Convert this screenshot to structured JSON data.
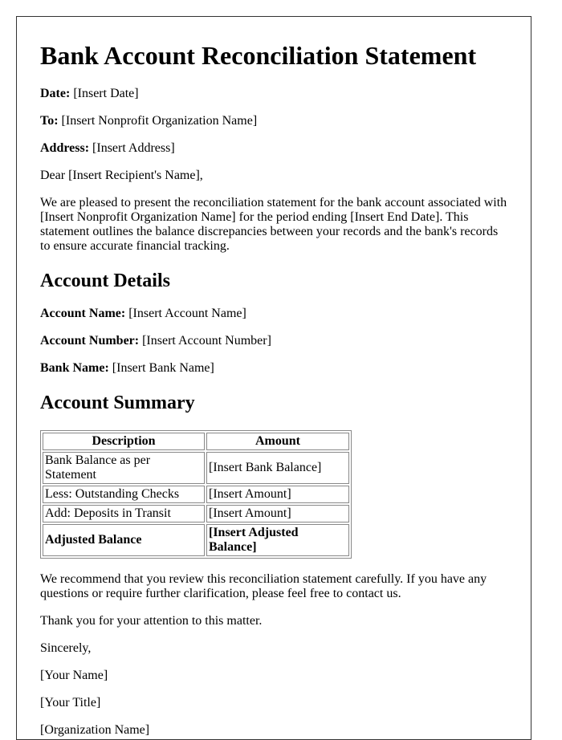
{
  "title": "Bank Account Reconciliation Statement",
  "header_fields": [
    {
      "label": "Date:",
      "value": " [Insert Date]"
    },
    {
      "label": "To:",
      "value": " [Insert Nonprofit Organization Name]"
    },
    {
      "label": "Address:",
      "value": " [Insert Address]"
    }
  ],
  "salutation": "Dear [Insert Recipient's Name],",
  "intro": "We are pleased to present the reconciliation statement for the bank account associated with [Insert Nonprofit Organization Name] for the period ending [Insert End Date]. This statement outlines the balance discrepancies between your records and the bank's records to ensure accurate financial tracking.",
  "account_details": {
    "heading": "Account Details",
    "fields": [
      {
        "label": "Account Name:",
        "value": " [Insert Account Name]"
      },
      {
        "label": "Account Number:",
        "value": " [Insert Account Number]"
      },
      {
        "label": "Bank Name:",
        "value": " [Insert Bank Name]"
      }
    ]
  },
  "account_summary": {
    "heading": "Account Summary",
    "columns": [
      "Description",
      "Amount"
    ],
    "rows": [
      {
        "description": "Bank Balance as per Statement",
        "amount": "[Insert Bank Balance]"
      },
      {
        "description": "Less: Outstanding Checks",
        "amount": "[Insert Amount]"
      },
      {
        "description": "Add: Deposits in Transit",
        "amount": "[Insert Amount]"
      },
      {
        "description": "Adjusted Balance",
        "amount": "[Insert Adjusted Balance]"
      }
    ]
  },
  "closing_paragraph": "We recommend that you review this reconciliation statement carefully. If you have any questions or require further clarification, please feel free to contact us.",
  "thanks": "Thank you for your attention to this matter.",
  "sign_off": "Sincerely,",
  "signature": {
    "name": "[Your Name]",
    "title": "[Your Title]",
    "organization": "[Organization Name]"
  }
}
